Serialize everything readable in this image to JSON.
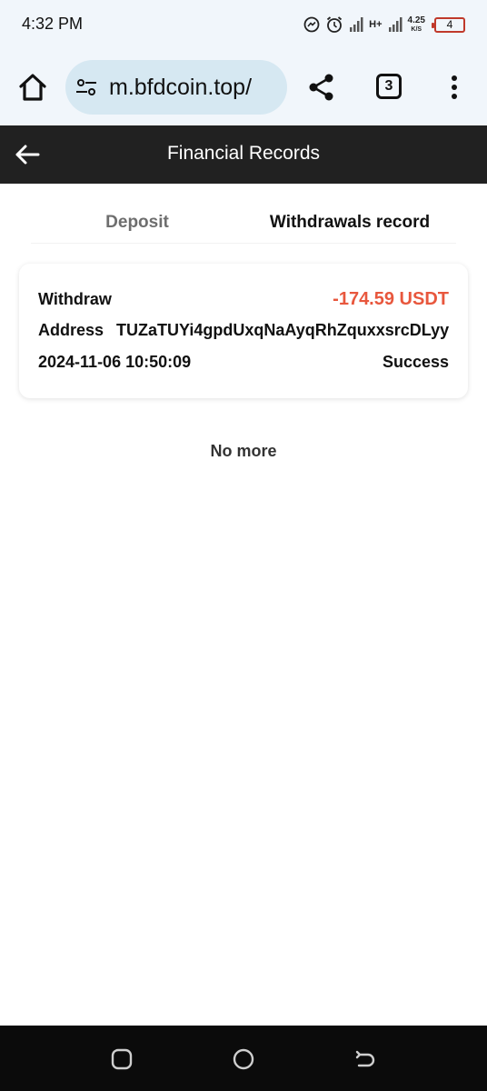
{
  "status_bar": {
    "time": "4:32 PM",
    "network_label": "H+",
    "speed_value": "4.25",
    "speed_unit": "K/S",
    "battery_level": "4"
  },
  "browser": {
    "url": "m.bfdcoin.top/",
    "tab_count": "3"
  },
  "header": {
    "title": "Financial Records"
  },
  "tabs": [
    {
      "label": "Deposit",
      "active": false
    },
    {
      "label": "Withdrawals record",
      "active": true
    }
  ],
  "records": [
    {
      "type": "Withdraw",
      "amount": "-174.59 USDT",
      "address_label": "Address",
      "address": "TUZaTUYi4gpdUxqNaAyqRhZquxxsrcDLyy",
      "datetime": "2024-11-06 10:50:09",
      "status": "Success"
    }
  ],
  "list_end_text": "No more",
  "colors": {
    "header_bg": "#212121",
    "amount_negative": "#e8573d",
    "url_pill": "#d6e8f2",
    "battery_low": "#c0392b"
  }
}
